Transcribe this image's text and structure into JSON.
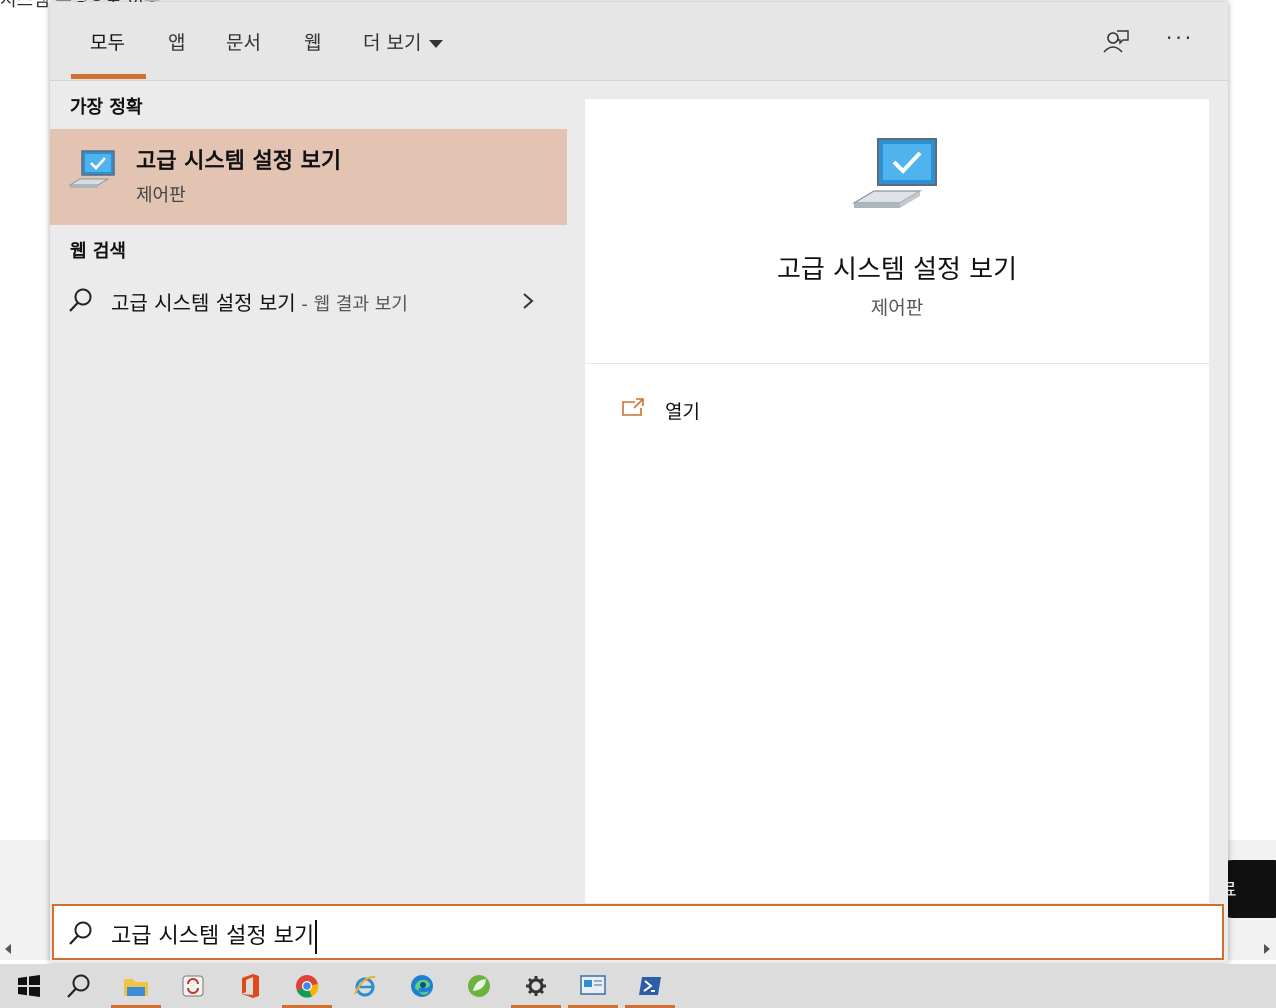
{
  "background": {
    "peek_text": "시스템 속성으로 이동",
    "button_text": "료"
  },
  "tabs": [
    {
      "label": "모두",
      "active": true
    },
    {
      "label": "앱"
    },
    {
      "label": "문서"
    },
    {
      "label": "웹"
    },
    {
      "label": "더 보기"
    }
  ],
  "toolbar": {
    "feedback_icon": "feedback-person-icon",
    "more_label": "···"
  },
  "left": {
    "best_match_header": "가장 정확",
    "best_match": {
      "title": "고급 시스템 설정 보기",
      "subtitle": "제어판",
      "icon": "computer-monitor-icon"
    },
    "web_header": "웹 검색",
    "web_result": {
      "title": "고급 시스템 설정 보기",
      "suffix": " - 웹 결과 보기"
    }
  },
  "right": {
    "title": "고급 시스템 설정 보기",
    "subtitle": "제어판",
    "actions": [
      {
        "label": "열기",
        "icon": "open-external-icon"
      }
    ]
  },
  "search": {
    "value": "고급 시스템 설정 보기"
  },
  "taskbar": {
    "items": [
      "windows-start-icon",
      "search-icon",
      "file-explorer-icon",
      "sync-app-icon",
      "office-icon",
      "chrome-icon",
      "internet-explorer-icon",
      "edge-icon",
      "leaf-app-icon",
      "settings-gear-icon",
      "system-properties-icon",
      "powershell-icon"
    ]
  },
  "colors": {
    "accent": "#d06f2f",
    "selected_bg": "#e3c4b3",
    "panel_bg": "#ebebeb"
  }
}
